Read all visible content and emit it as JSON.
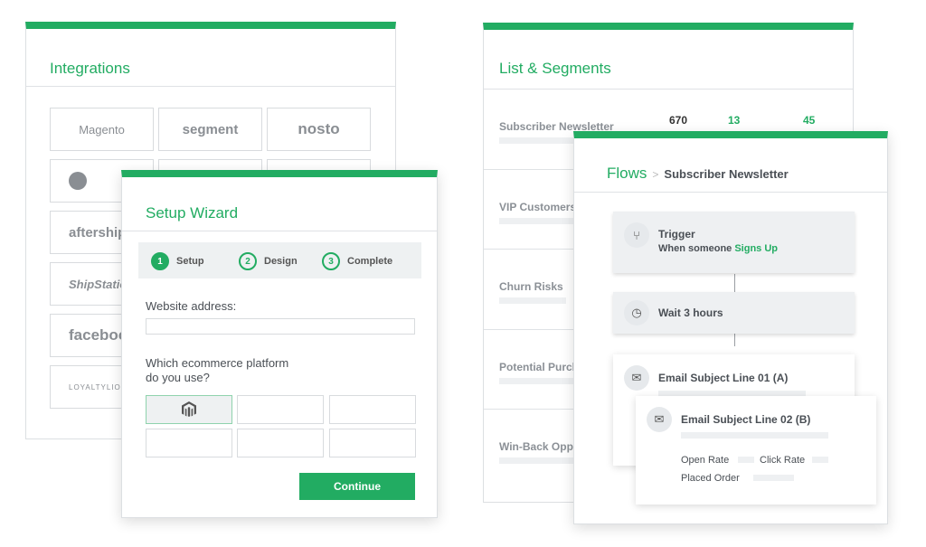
{
  "integrations": {
    "title": "Integrations",
    "tiles": [
      "Magento",
      "segment",
      "nosto",
      "",
      "",
      "",
      "aftership",
      "",
      "",
      "ShipStation",
      "",
      "",
      "facebook",
      "",
      "",
      "LOYALTYLION",
      "",
      ""
    ]
  },
  "wizard": {
    "title": "Setup Wizard",
    "steps": [
      {
        "num": "1",
        "label": "Setup"
      },
      {
        "num": "2",
        "label": "Design"
      },
      {
        "num": "3",
        "label": "Complete"
      }
    ],
    "website_label": "Website address:",
    "website_value": "",
    "platform_q1": "Which ecommerce platform",
    "platform_q2": "do you use?",
    "selected_platform": "magento-icon",
    "continue": "Continue",
    "accent": "#22ac62"
  },
  "lists": {
    "title": "List & Segments",
    "rows": [
      {
        "name": "Subscriber Newsletter",
        "v1": "670",
        "v2": "13",
        "v3": "45"
      },
      {
        "name": "VIP Customers"
      },
      {
        "name": "Churn Risks"
      },
      {
        "name": "Potential Purchasers"
      },
      {
        "name": "Win-Back Opportunities"
      }
    ]
  },
  "flows": {
    "crumb": "Flows",
    "title": "Subscriber Newsletter",
    "trigger_title": "Trigger",
    "trigger_text": "When someone ",
    "trigger_event": "Signs Up",
    "wait": "Wait 3 hours",
    "email_a": "Email Subject Line 01 (A)",
    "email_b": "Email Subject Line 02 (B)",
    "open_rate": "Open Rate",
    "click_rate": "Click Rate",
    "placed_order": "Placed Order"
  }
}
